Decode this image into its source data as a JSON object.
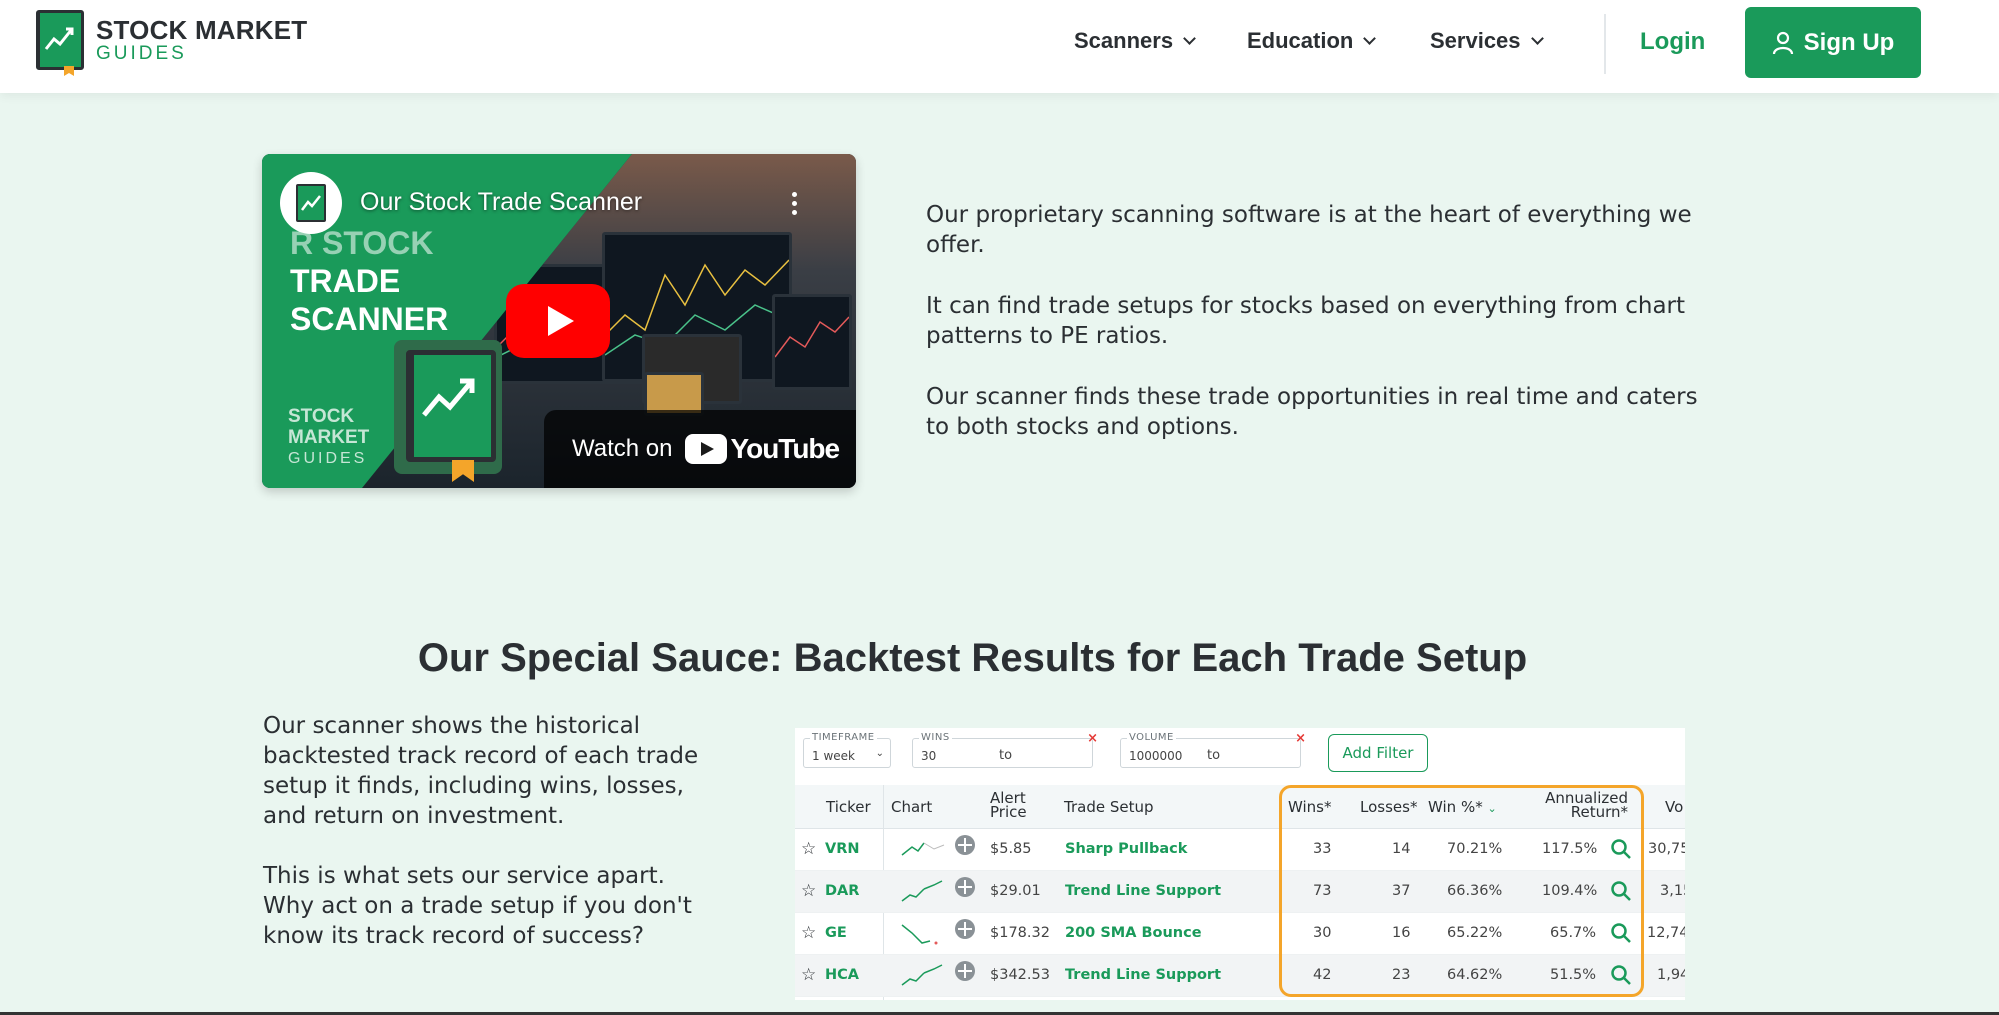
{
  "header": {
    "logo_line1": "STOCK MARKET",
    "logo_line2": "GUIDES",
    "nav": [
      "Scanners",
      "Education",
      "Services"
    ],
    "login": "Login",
    "signup": "Sign Up"
  },
  "video": {
    "title": "Our Stock Trade Scanner",
    "thumb_line1": "R STOCK",
    "thumb_line2": "TRADE",
    "thumb_line3": "SCANNER",
    "brand_line1": "STOCK",
    "brand_line2": "MARKET",
    "brand_line3": "GUIDES",
    "watch_on": "Watch on",
    "youtube": "YouTube"
  },
  "intro": [
    "Our proprietary scanning software is at the heart of everything we offer.",
    "It can find trade setups for stocks based on everything from chart patterns to PE ratios.",
    "Our scanner finds these trade opportunities in real time and caters to both stocks and options."
  ],
  "section": {
    "title": "Our Special Sauce:  Backtest Results for Each Trade Setup",
    "left_paragraphs": [
      "Our scanner shows the historical backtested track record of each trade setup it finds, including wins, losses, and return on investment.",
      "This is what sets our service apart. Why act on a trade setup if you don't know its track record of success?"
    ]
  },
  "scanner": {
    "filters": {
      "timeframe_label": "TIMEFRAME",
      "timeframe_value": "1 week",
      "wins_label": "WINS",
      "wins_value": "30",
      "wins_to": "to",
      "volume_label": "VOLUME",
      "volume_value": "1000000",
      "volume_to": "to",
      "add_filter": "Add Filter"
    },
    "headers": {
      "ticker": "Ticker",
      "chart": "Chart",
      "alert_price_1": "Alert",
      "alert_price_2": "Price",
      "trade_setup": "Trade Setup",
      "wins": "Wins*",
      "losses": "Losses*",
      "win_pct": "Win %*",
      "annual_1": "Annualized",
      "annual_2": "Return*",
      "volume": "Vo"
    },
    "rows": [
      {
        "ticker": "VRN",
        "price": "$5.85",
        "setup": "Sharp Pullback",
        "wins": "33",
        "losses": "14",
        "win_pct": "70.21%",
        "annual": "117.5%",
        "volume": "30,75"
      },
      {
        "ticker": "DAR",
        "price": "$29.01",
        "setup": "Trend Line Support",
        "wins": "73",
        "losses": "37",
        "win_pct": "66.36%",
        "annual": "109.4%",
        "volume": "3,15"
      },
      {
        "ticker": "GE",
        "price": "$178.32",
        "setup": "200 SMA Bounce",
        "wins": "30",
        "losses": "16",
        "win_pct": "65.22%",
        "annual": "65.7%",
        "volume": "12,74"
      },
      {
        "ticker": "HCA",
        "price": "$342.53",
        "setup": "Trend Line Support",
        "wins": "42",
        "losses": "23",
        "win_pct": "64.62%",
        "annual": "51.5%",
        "volume": "1,94"
      }
    ]
  },
  "colors": {
    "brand_green": "#1a9a5a",
    "background": "#eaf6f0",
    "highlight_orange": "#f4a52a"
  }
}
